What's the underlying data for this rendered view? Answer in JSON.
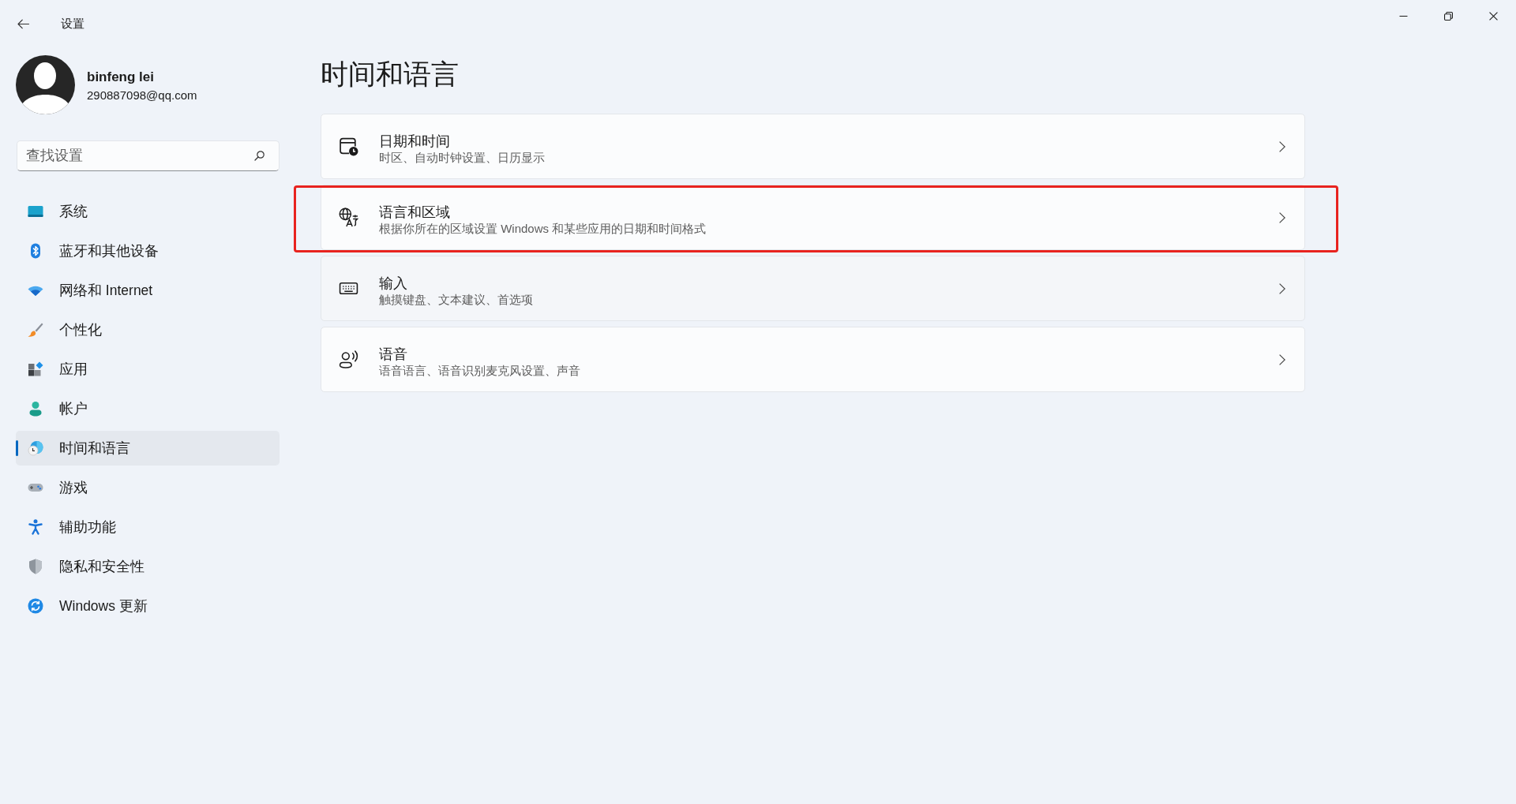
{
  "window": {
    "title": "设置"
  },
  "profile": {
    "name": "binfeng lei",
    "email": "290887098@qq.com"
  },
  "search": {
    "placeholder": "查找设置"
  },
  "nav": [
    {
      "label": "系统",
      "selected": false
    },
    {
      "label": "蓝牙和其他设备",
      "selected": false
    },
    {
      "label": "网络和 Internet",
      "selected": false
    },
    {
      "label": "个性化",
      "selected": false
    },
    {
      "label": "应用",
      "selected": false
    },
    {
      "label": "帐户",
      "selected": false
    },
    {
      "label": "时间和语言",
      "selected": true
    },
    {
      "label": "游戏",
      "selected": false
    },
    {
      "label": "辅助功能",
      "selected": false
    },
    {
      "label": "隐私和安全性",
      "selected": false
    },
    {
      "label": "Windows 更新",
      "selected": false
    }
  ],
  "page": {
    "title": "时间和语言"
  },
  "cards": [
    {
      "title": "日期和时间",
      "subtitle": "时区、自动时钟设置、日历显示",
      "hovered": false,
      "highlighted": false
    },
    {
      "title": "语言和区域",
      "subtitle": "根据你所在的区域设置 Windows 和某些应用的日期和时间格式",
      "hovered": false,
      "highlighted": true
    },
    {
      "title": "输入",
      "subtitle": "触摸键盘、文本建议、首选项",
      "hovered": true,
      "highlighted": false
    },
    {
      "title": "语音",
      "subtitle": "语音语言、语音识别麦克风设置、声音",
      "hovered": false,
      "highlighted": false
    }
  ]
}
